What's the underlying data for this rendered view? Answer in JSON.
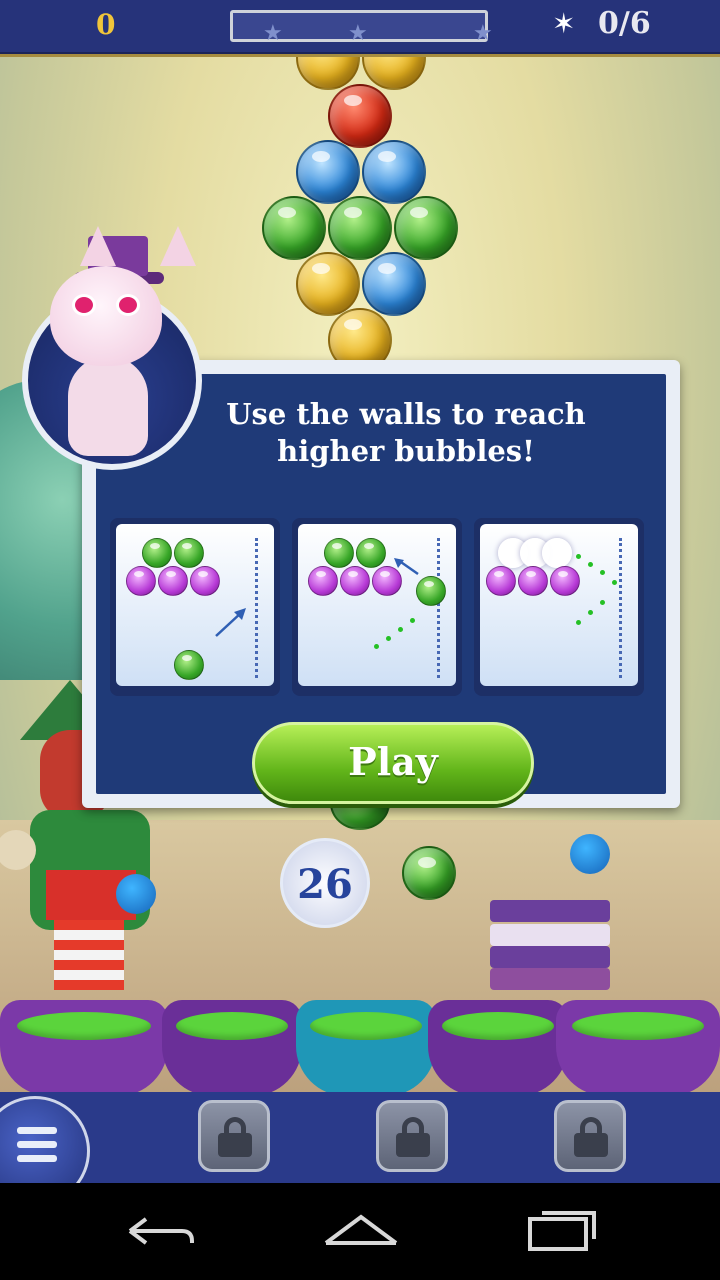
{
  "hud": {
    "score": "0",
    "stars_collected": "0/6",
    "progress_fraction": 0.0
  },
  "board": {
    "bubbles": [
      "yellow",
      "yellow",
      "red",
      "blue",
      "blue",
      "green",
      "green",
      "green",
      "yellow",
      "blue",
      "yellow"
    ],
    "next_bubble": "green",
    "shots_remaining": "26"
  },
  "tutorial": {
    "message_line1": "Use the walls to reach",
    "message_line2": "higher bubbles!",
    "play_label": "Play"
  },
  "colors": {
    "hud_bar": "#26337a",
    "panel_blue": "#1f3a78",
    "play_green": "#62b51a",
    "score_gold": "#f0c53a"
  },
  "icons": {
    "menu": "menu-icon",
    "lock": "lock-icon",
    "star": "star-icon",
    "back": "back-icon",
    "home": "home-icon",
    "recents": "recents-icon"
  }
}
